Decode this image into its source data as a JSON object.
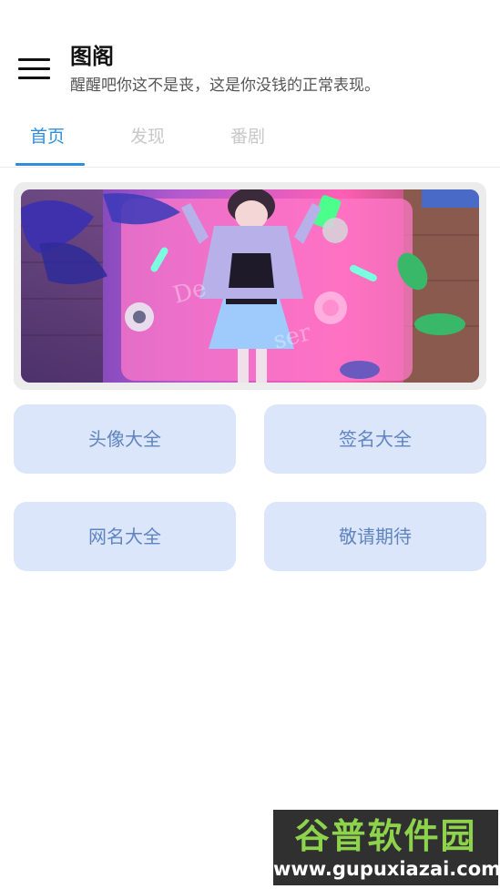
{
  "header": {
    "menu_icon": "hamburger-menu-icon",
    "title": "图阁",
    "subtitle": "醒醒吧你这不是丧，这是你没钱的正常表现。"
  },
  "tabs": {
    "items": [
      {
        "label": "首页",
        "active": true
      },
      {
        "label": "发现",
        "active": false
      },
      {
        "label": "番剧",
        "active": false
      }
    ],
    "active_color": "#2f8ddc",
    "inactive_color": "#c8c8c8"
  },
  "banner": {
    "image": "anime-girl-neon-room-illustration"
  },
  "cards": [
    {
      "label": "头像大全"
    },
    {
      "label": "签名大全"
    },
    {
      "label": "网名大全"
    },
    {
      "label": "敬请期待"
    }
  ],
  "colors": {
    "card_background": "#dbe6fb",
    "card_text": "#5f84bf"
  },
  "watermark": {
    "title": "谷普软件园",
    "url": "www.gupuxiazai.com"
  }
}
